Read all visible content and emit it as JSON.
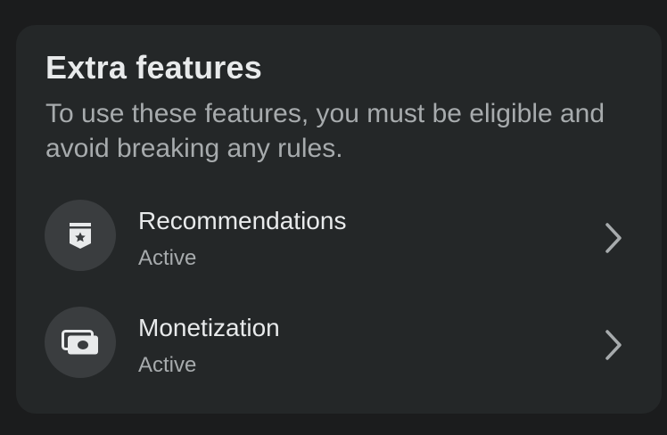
{
  "card": {
    "title": "Extra features",
    "description": "To use these features, you must be eligible and avoid breaking any rules."
  },
  "features": [
    {
      "label": "Recommendations",
      "status": "Active",
      "icon": "badge-star-icon"
    },
    {
      "label": "Monetization",
      "status": "Active",
      "icon": "money-icon"
    }
  ],
  "colors": {
    "background": "#1b1c1d",
    "card": "#242728",
    "icon_circle": "#3a3d3f",
    "primary_text": "#e8eaeb",
    "secondary_text": "#a7abad"
  }
}
